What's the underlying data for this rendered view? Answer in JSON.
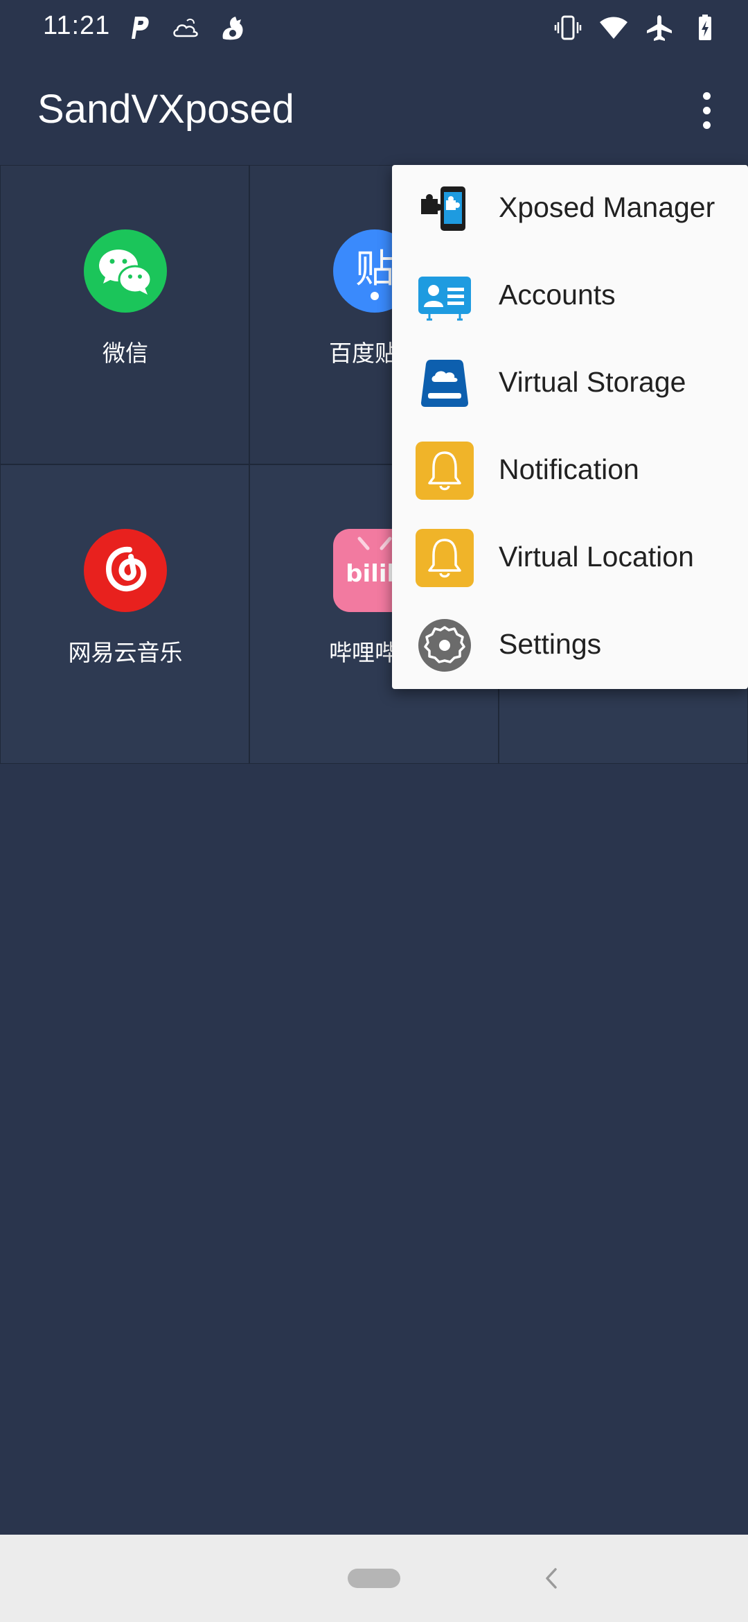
{
  "status_bar": {
    "time": "11:21",
    "left_icons": [
      "p-app-icon",
      "cloud-weather-icon",
      "squirrel-icon"
    ],
    "right_icons": [
      "vibrate-icon",
      "wifi-icon",
      "airplane-mode-icon",
      "battery-charging-icon"
    ]
  },
  "app_bar": {
    "title": "SandVXposed",
    "overflow_icon": "more-vert-icon"
  },
  "apps": [
    {
      "label": "微信",
      "icon": "wechat-icon",
      "color": "#1bc55a"
    },
    {
      "label": "百度贴吧",
      "icon": "baidu-tieba-icon",
      "color": "#3a8afc"
    },
    {
      "label": "",
      "icon": "",
      "color": ""
    },
    {
      "label": "网易云音乐",
      "icon": "netease-music-icon",
      "color": "#e8211e"
    },
    {
      "label": "哔哩哔哩",
      "icon": "bilibili-icon",
      "color": "#f27aa0"
    },
    {
      "label": "",
      "icon": "",
      "color": ""
    }
  ],
  "menu": {
    "items": [
      {
        "label": "Xposed Manager",
        "icon": "xposed-puzzle-icon"
      },
      {
        "label": "Accounts",
        "icon": "accounts-card-icon"
      },
      {
        "label": "Virtual Storage",
        "icon": "cloud-storage-icon"
      },
      {
        "label": "Notification",
        "icon": "bell-icon"
      },
      {
        "label": "Virtual Location",
        "icon": "bell-icon"
      },
      {
        "label": "Settings",
        "icon": "gear-icon"
      }
    ]
  },
  "nav_bar": {
    "home_icon": "home-pill-icon",
    "back_icon": "back-chevron-icon"
  },
  "colors": {
    "background": "#2a354d",
    "menu_background": "#fafafa",
    "accent_yellow": "#f0b429",
    "accent_blue": "#1e9be0",
    "storage_blue": "#0d5fae"
  }
}
